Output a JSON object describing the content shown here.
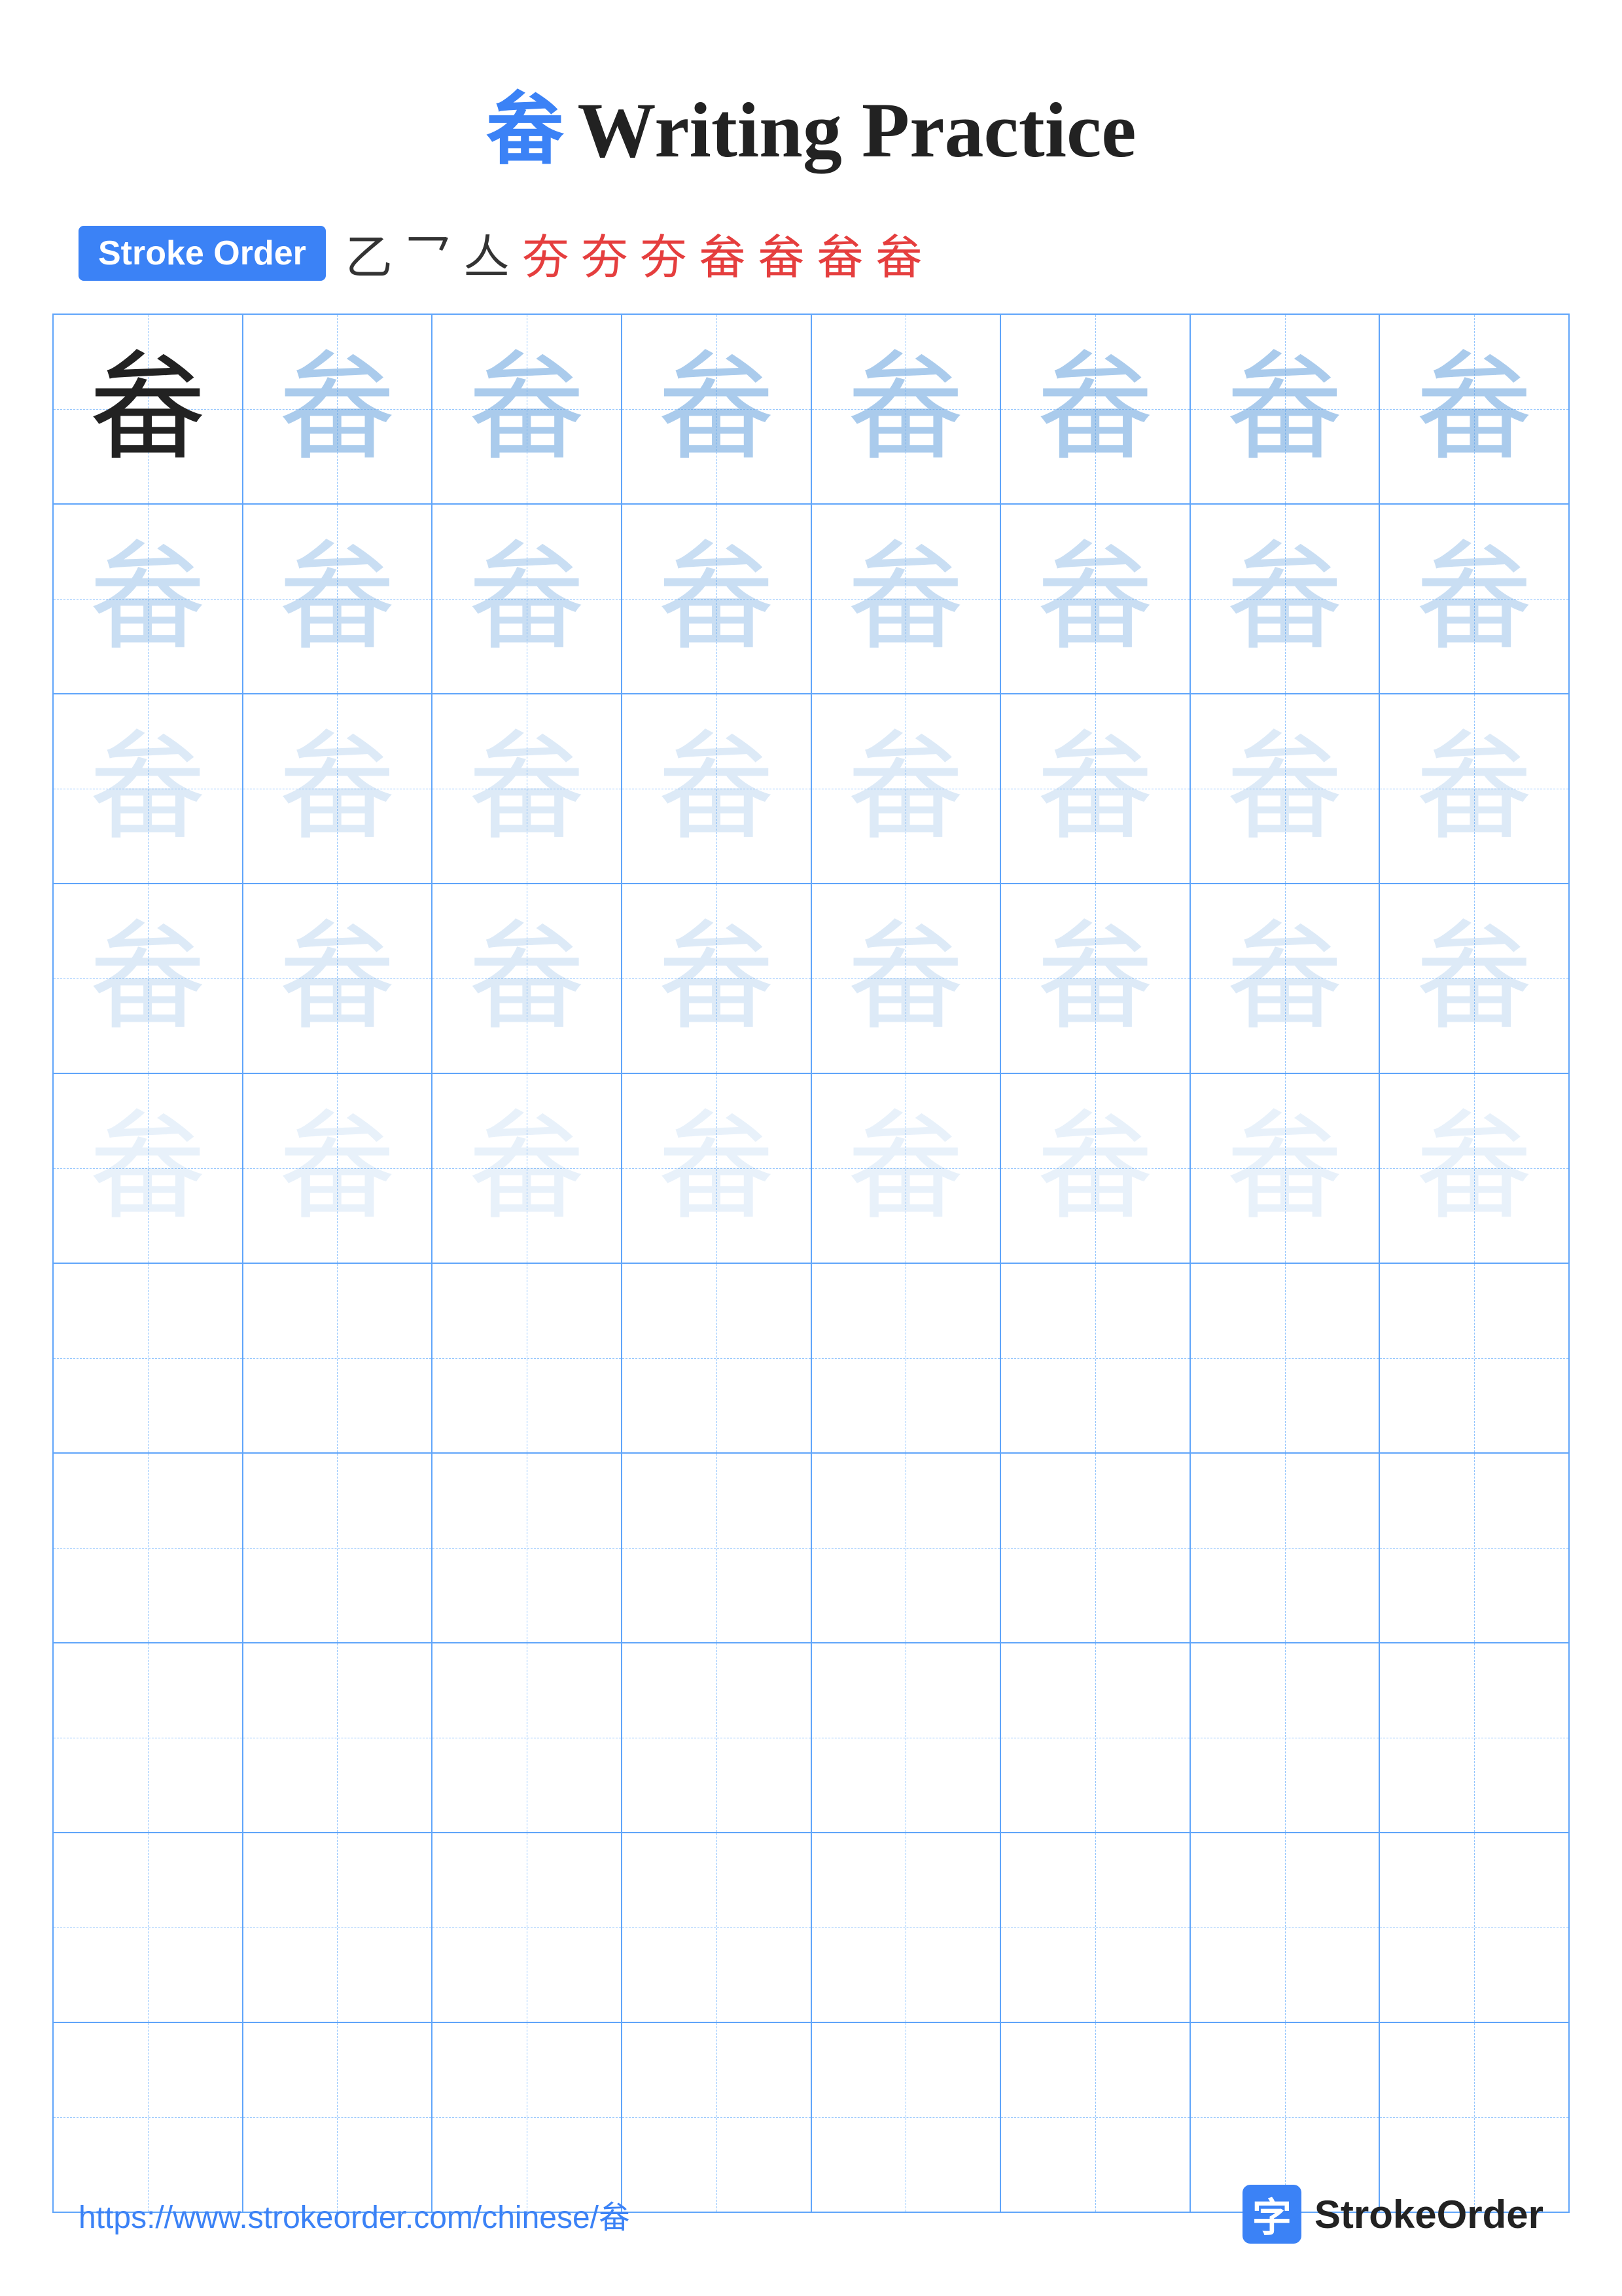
{
  "title": {
    "char": "畚",
    "label": "Writing Practice"
  },
  "stroke_order": {
    "badge_label": "Stroke Order",
    "sequence": [
      "乙",
      "乙",
      "亼",
      "夯",
      "夯",
      "夯",
      "畚",
      "畚",
      "畚",
      "畚"
    ],
    "red_from": 4
  },
  "grid": {
    "char": "畚",
    "rows": 10,
    "cols": 8,
    "practice_rows": 5,
    "empty_rows": 5
  },
  "footer": {
    "url": "https://www.strokeorder.com/chinese/畚",
    "brand": "StrokeOrder"
  }
}
